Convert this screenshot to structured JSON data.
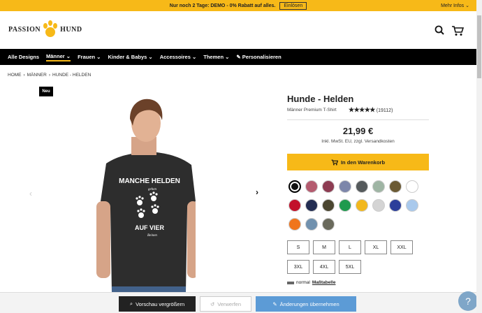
{
  "promo": {
    "text": "Nur noch 2 Tage:  DEMO - 0% Rabatt auf alles.",
    "button": "Einlösen",
    "more": "Mehr Infos"
  },
  "header": {
    "logo_left": "PASSION",
    "logo_right": "HUND",
    "icons": [
      "search-icon",
      "cart-icon"
    ]
  },
  "nav": {
    "items": [
      "Alle Designs",
      "Männer",
      "Frauen",
      "Kinder & Babys",
      "Accessoires",
      "Themen",
      "Personalisieren"
    ]
  },
  "breadcrumb": [
    "HOME",
    "MÄNNER",
    "HUNDE - HELDEN"
  ],
  "badge": "Neu",
  "shirt": {
    "line1": "MANCHE HELDEN",
    "line2": "gehen",
    "line3": "AUF VIER",
    "line4": "Beinen"
  },
  "product": {
    "title": "Hunde - Helden",
    "subtitle": "Männer Premium T-Shirt",
    "stars": "★★★★★",
    "reviews": "(19112)",
    "price": "21,99 €",
    "tax": "Inkl. MwSt. EU, zzgl. Versandkosten",
    "cart_button": "In den Warenkorb"
  },
  "colors": [
    "#111111",
    "#b45b6f",
    "#8d3c52",
    "#7d86aa",
    "#555a5c",
    "#9fb5a4",
    "#6b5a34",
    "#ffffff",
    "#c2102a",
    "#232d52",
    "#4b4630",
    "#1f9a4e",
    "#f2b81e",
    "#d4d4d4",
    "#2c3f9a",
    "#a9c9ec",
    "#f0751c",
    "#7191ae",
    "#6a6a5c"
  ],
  "sizes": [
    "S",
    "M",
    "L",
    "XL",
    "XXL",
    "3XL",
    "4XL",
    "5XL"
  ],
  "fit": {
    "label": "normal",
    "link": "Maßtabelle"
  },
  "bottom": {
    "zoom": "Vorschau vergrößern",
    "discard": "Verwerfen",
    "apply": "Änderungen übernehmen"
  },
  "help": "?"
}
